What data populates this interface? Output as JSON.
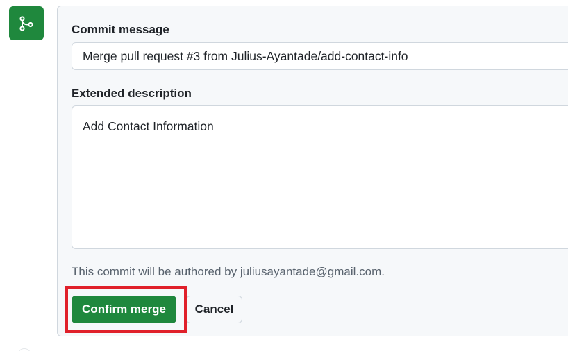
{
  "icons": {
    "merge_badge": "git-merge-icon"
  },
  "colors": {
    "primary_green": "#1f883d",
    "highlight_red": "#e0202a"
  },
  "form": {
    "commit_message_label": "Commit message",
    "commit_message_value": "Merge pull request #3 from Julius-Ayantade/add-contact-info",
    "extended_description_label": "Extended description",
    "extended_description_value": "Add Contact Information",
    "author_note": "This commit will be authored by juliusayantade@gmail.com."
  },
  "actions": {
    "confirm_label": "Confirm merge",
    "cancel_label": "Cancel"
  }
}
